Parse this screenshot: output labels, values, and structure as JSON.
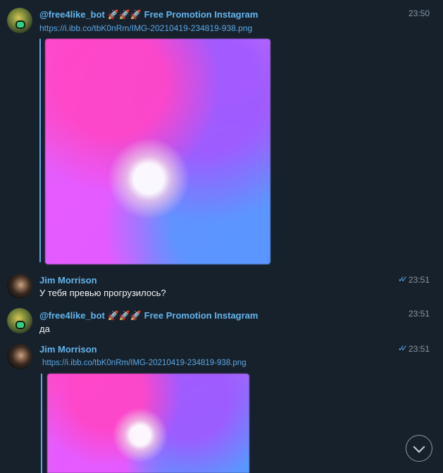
{
  "messages": [
    {
      "sender": "@free4like_bot 🚀🚀🚀 Free Promotion Instagram",
      "time": "23:50",
      "link": "https://i.ibb.co/tbK0nRm/IMG-20210419-234819-938.png"
    },
    {
      "sender": "Jim Morrison",
      "time": "23:51",
      "checks": "✓✓",
      "text": "У тебя превью прогрузилось?"
    },
    {
      "sender": "@free4like_bot 🚀🚀🚀 Free Promotion Instagram",
      "time": "23:51",
      "text": "да"
    },
    {
      "sender": "Jim Morrison",
      "time": "23:51",
      "checks": "✓✓",
      "link": "https://i.ibb.co/tbK0nRm/IMG-20210419-234819-938.png"
    }
  ],
  "icons": {
    "scroll_down": "chevron-down-icon",
    "read_receipt": "double-check-icon"
  },
  "colors": {
    "background": "#17212b",
    "sender": "#64b5ef",
    "link": "#5ba7e6",
    "text": "#f5f5f5",
    "time": "#8a98a6"
  }
}
